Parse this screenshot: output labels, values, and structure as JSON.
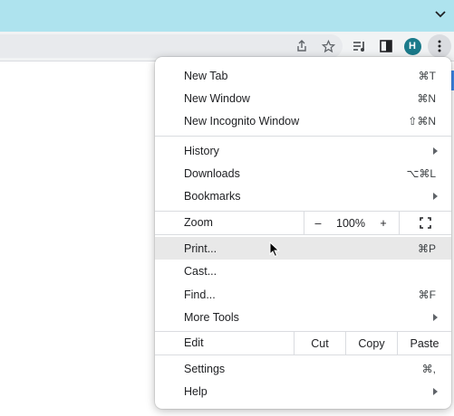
{
  "menu": {
    "items_group1": [
      {
        "label": "New Tab",
        "shortcut": "⌘T"
      },
      {
        "label": "New Window",
        "shortcut": "⌘N"
      },
      {
        "label": "New Incognito Window",
        "shortcut": "⇧⌘N"
      }
    ],
    "history": {
      "label": "History"
    },
    "downloads": {
      "label": "Downloads",
      "shortcut": "⌥⌘L"
    },
    "bookmarks": {
      "label": "Bookmarks"
    },
    "zoom": {
      "label": "Zoom",
      "minus": "–",
      "level": "100%",
      "plus": "+"
    },
    "print": {
      "label": "Print...",
      "shortcut": "⌘P"
    },
    "cast": {
      "label": "Cast..."
    },
    "find": {
      "label": "Find...",
      "shortcut": "⌘F"
    },
    "more_tools": {
      "label": "More Tools"
    },
    "edit": {
      "label": "Edit",
      "cut": "Cut",
      "copy": "Copy",
      "paste": "Paste"
    },
    "settings": {
      "label": "Settings",
      "shortcut": "⌘,"
    },
    "help": {
      "label": "Help"
    }
  },
  "toolbar": {
    "avatar_initial": "H"
  },
  "colors": {
    "titlebar": "#aee3ee",
    "avatar": "#1a7a8a",
    "hover": "#e8e8e8"
  }
}
